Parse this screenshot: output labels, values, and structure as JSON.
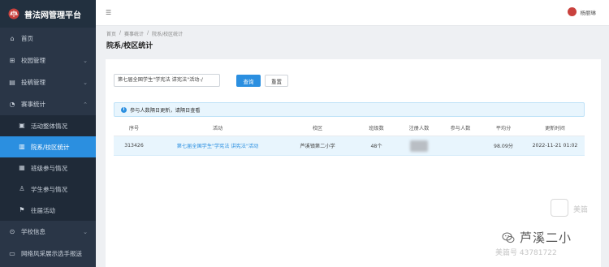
{
  "app": {
    "title": "普法网管理平台"
  },
  "header": {
    "menu_icon": "menu-fold-icon",
    "user_name": "杨丽琳"
  },
  "sidebar": {
    "items": [
      {
        "label": "首页",
        "icon": "home-icon"
      },
      {
        "label": "校园管理",
        "icon": "school-icon",
        "expandable": true
      },
      {
        "label": "投稿管理",
        "icon": "document-icon",
        "expandable": true
      },
      {
        "label": "赛事统计",
        "icon": "chart-icon",
        "expandable": true,
        "expanded": true
      },
      {
        "label": "学校信息",
        "icon": "info-icon",
        "expandable": true
      },
      {
        "label": "网络风采展示选手报送",
        "icon": "upload-icon"
      }
    ],
    "sub_items": [
      {
        "label": "活动整体情况",
        "icon": "report-icon"
      },
      {
        "label": "院系/校区统计",
        "icon": "bar-chart-icon",
        "active": true
      },
      {
        "label": "班级参与情况",
        "icon": "class-icon"
      },
      {
        "label": "学生参与情况",
        "icon": "user-icon"
      },
      {
        "label": "往届活动",
        "icon": "flag-icon"
      }
    ]
  },
  "breadcrumb": [
    "首页",
    "/",
    "赛事统计",
    "/",
    "院系/校区统计"
  ],
  "page_title": "院系/校区统计",
  "search": {
    "value": "第七届全国学生\"学宪法 讲宪法\"活动-/",
    "query_button": "查询",
    "reset_button": "重置"
  },
  "notice": {
    "text": "参与人数隔日更新，请隔日查看"
  },
  "table": {
    "columns": [
      "序号",
      "活动",
      "校区",
      "班级数",
      "注册人数",
      "参与人数",
      "平均分",
      "更新时间"
    ],
    "rows": [
      {
        "id": "313426",
        "activity": "第七届全国学生\"学宪法 讲宪法\"活动",
        "campus": "芦溪镇第二小学",
        "classes": "48个",
        "registered": "",
        "participants": "",
        "avg_score": "98.09分",
        "updated": "2022-11-21 01:02"
      }
    ]
  },
  "watermark": {
    "app_text": "美篇",
    "brand": "芦溪二小",
    "id_text": "美篇号 43781722"
  },
  "colors": {
    "sidebar": "#2a3647",
    "accent": "#2b8fe0",
    "notice_bg": "#e8f5fd",
    "brand_red": "#c9413d"
  }
}
